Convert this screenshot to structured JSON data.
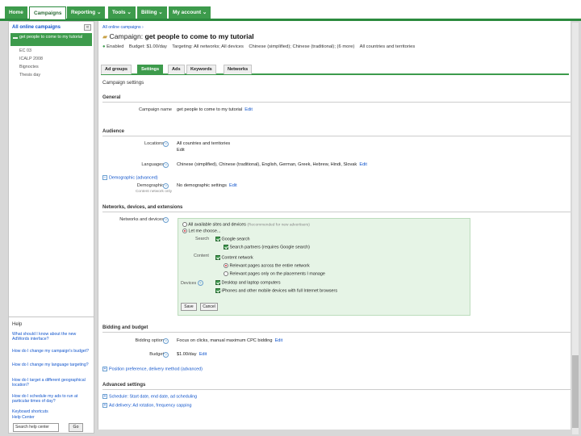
{
  "topnav": {
    "tabs": [
      {
        "label": "Home"
      },
      {
        "label": "Campaigns"
      },
      {
        "label": "Reporting ⌄"
      },
      {
        "label": "Tools ⌄"
      },
      {
        "label": "Billing ⌄"
      },
      {
        "label": "My account ⌄"
      }
    ]
  },
  "sidebar": {
    "header": "All online campaigns",
    "collapse_icon": "«",
    "selected": "get people to come to my tutorial",
    "items": [
      "EC 03",
      "ICALP 2008",
      "Bignoctes",
      "Thesis day"
    ]
  },
  "help": {
    "title": "Help",
    "links": [
      "What should I know about the new AdWords interface?",
      "How do I change my campaign's budget?",
      "How do I change my language targeting?",
      "How do I target a different geographical location?",
      "How do I schedule my ads to run at particular times of day?",
      "Keyboard shortcuts",
      "Help Center"
    ],
    "search_placeholder": "Search help center",
    "go_label": "Go"
  },
  "campaign": {
    "breadcrumb": "All online campaigns ›",
    "title_prefix": "Campaign:",
    "title": "get people to come to my tutorial",
    "status": {
      "enabled": "Enabled",
      "budget": "Budget: $1.00/day",
      "targeting": "Targeting: All networks; All devices",
      "languages": "Chinese (simplified); Chinese (traditional); (6 more)",
      "locations": "All countries and territories"
    }
  },
  "tabs": [
    "Ad groups",
    "Settings",
    "Ads",
    "Keywords",
    "Networks"
  ],
  "settings": {
    "heading": "Campaign settings",
    "general": {
      "title": "General",
      "campaign_name_label": "Campaign name",
      "campaign_name": "get people to come to my tutorial",
      "edit": "Edit"
    },
    "audience": {
      "title": "Audience",
      "locations_label": "Locations",
      "locations_value": "All countries and territories",
      "languages_label": "Languages",
      "languages_value": "Chinese (simplified), Chinese (traditional), English, German, Greek, Hebrew, Hindi, Slovak",
      "demographic_toggle": "Demographic (advanced)",
      "demographic_label": "Demographic",
      "demographic_sub": "Content network only",
      "demographic_value": "No demographic settings",
      "edit": "Edit"
    },
    "networks": {
      "title": "Networks, devices, and extensions",
      "label": "Networks and devices",
      "opt_all": "All available sites and devices",
      "opt_all_note": "(Recommended for new advertisers)",
      "opt_choose": "Let me choose...",
      "search_label": "Search",
      "google_search": "Google search",
      "search_partners": "Search partners (requires Google search)",
      "content_label": "Content",
      "content_network": "Content network",
      "relevant_entire": "Relevant pages across the entire network",
      "relevant_placements": "Relevant pages only on the placements I manage",
      "devices_label": "Devices",
      "desktop": "Desktop and laptop computers",
      "iphones": "iPhones and other mobile devices with full Internet browsers",
      "save": "Save",
      "cancel": "Cancel"
    },
    "bidding": {
      "title": "Bidding and budget",
      "option_label": "Bidding option",
      "option_value": "Focus on clicks, manual maximum CPC bidding",
      "budget_label": "Budget",
      "budget_value": "$1.00/day",
      "edit": "Edit",
      "position_pref": "Position preference, delivery method (advanced)"
    },
    "advanced": {
      "title": "Advanced settings",
      "schedule": "Schedule: Start date, end date, ad scheduling",
      "delivery": "Ad delivery: Ad rotation, frequency capping"
    }
  }
}
